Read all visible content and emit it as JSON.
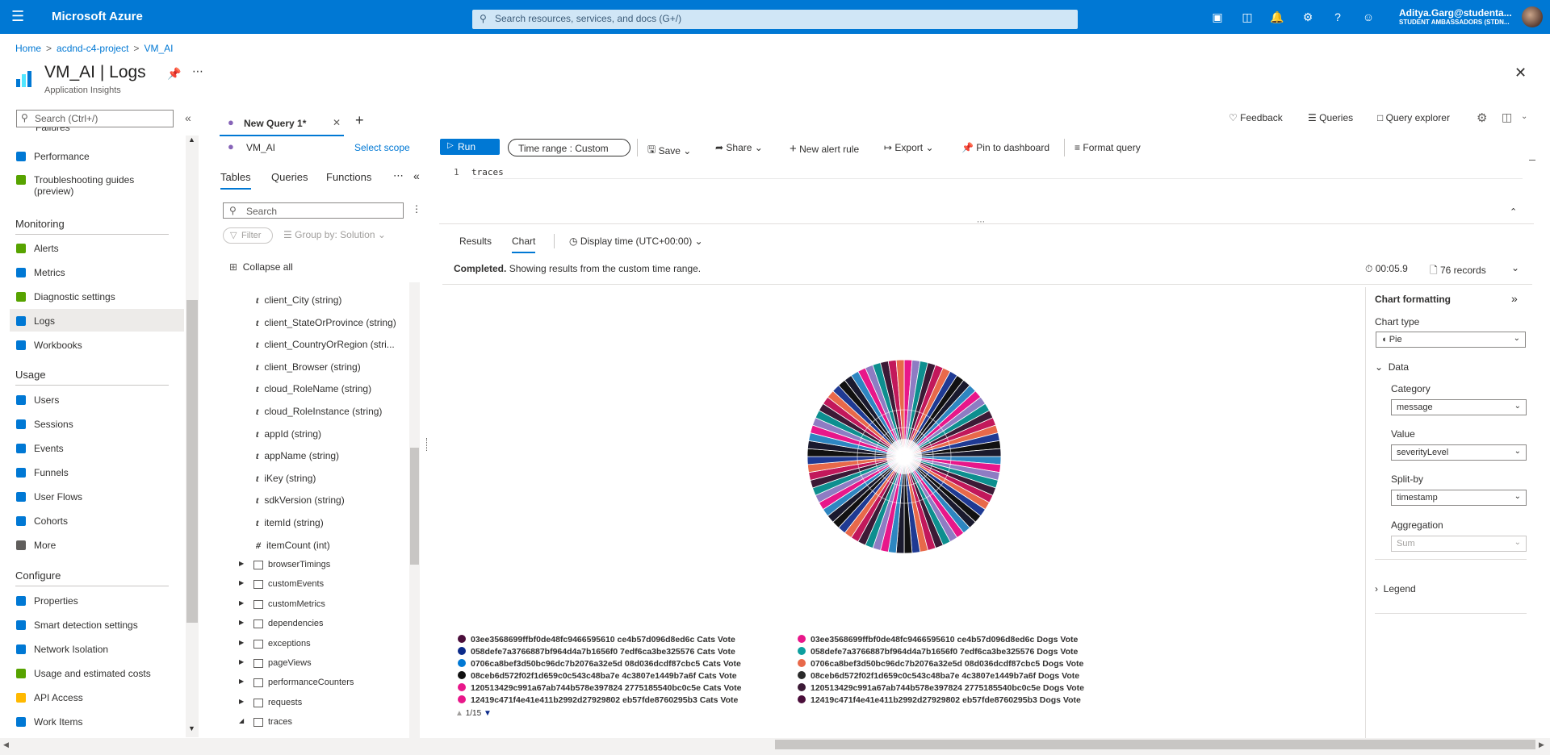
{
  "topbar": {
    "brand": "Microsoft Azure",
    "search_placeholder": "Search resources, services, and docs (G+/)",
    "user_name": "Aditya.Garg@studenta...",
    "user_org": "STUDENT AMBASSADORS (STDN..."
  },
  "breadcrumb": [
    "Home",
    "acdnd-c4-project",
    "VM_AI"
  ],
  "page": {
    "title": "VM_AI | Logs",
    "subtitle": "Application Insights"
  },
  "leftnav": {
    "search_placeholder": "Search (Ctrl+/)",
    "partial_item": "Failures",
    "items_top": [
      {
        "label": "Performance",
        "color": "#0078d4"
      },
      {
        "label": "Troubleshooting guides",
        "label2": "(preview)",
        "color": "#57a300"
      }
    ],
    "monitoring": {
      "title": "Monitoring",
      "items": [
        {
          "label": "Alerts",
          "color": "#57a300"
        },
        {
          "label": "Metrics",
          "color": "#0078d4"
        },
        {
          "label": "Diagnostic settings",
          "color": "#57a300"
        },
        {
          "label": "Logs",
          "color": "#0078d4"
        },
        {
          "label": "Workbooks",
          "color": "#0078d4"
        }
      ]
    },
    "usage": {
      "title": "Usage",
      "items": [
        {
          "label": "Users",
          "color": "#0078d4"
        },
        {
          "label": "Sessions",
          "color": "#0078d4"
        },
        {
          "label": "Events",
          "color": "#0078d4"
        },
        {
          "label": "Funnels",
          "color": "#0078d4"
        },
        {
          "label": "User Flows",
          "color": "#0078d4"
        },
        {
          "label": "Cohorts",
          "color": "#0078d4"
        },
        {
          "label": "More",
          "color": "#605e5c"
        }
      ]
    },
    "configure": {
      "title": "Configure",
      "items": [
        {
          "label": "Properties",
          "color": "#0078d4"
        },
        {
          "label": "Smart detection settings",
          "color": "#0078d4"
        },
        {
          "label": "Network Isolation",
          "color": "#0078d4"
        },
        {
          "label": "Usage and estimated costs",
          "color": "#57a300"
        },
        {
          "label": "API Access",
          "color": "#ffb900"
        },
        {
          "label": "Work Items",
          "color": "#0078d4"
        }
      ]
    }
  },
  "query_tab": {
    "label": "New Query 1*",
    "add": "+"
  },
  "scope": {
    "name": "VM_AI",
    "select_scope": "Select scope"
  },
  "toolbar": {
    "run": "Run",
    "time_range_label": "Time range :",
    "time_range_value": "Custom",
    "save": "Save",
    "share": "Share",
    "new_alert": "New alert rule",
    "export": "Export",
    "pin": "Pin to dashboard",
    "format": "Format query"
  },
  "right_toolbar": {
    "feedback": "Feedback",
    "queries": "Queries",
    "query_explorer": "Query explorer"
  },
  "schema": {
    "tabs": [
      "Tables",
      "Queries",
      "Functions"
    ],
    "search_placeholder": "Search",
    "filter": "Filter",
    "group_by": "Group by: Solution",
    "collapse_all": "Collapse all",
    "fields": [
      {
        "t": "t",
        "name": "client_City (string)"
      },
      {
        "t": "t",
        "name": "client_StateOrProvince (string)"
      },
      {
        "t": "t",
        "name": "client_CountryOrRegion (stri..."
      },
      {
        "t": "t",
        "name": "client_Browser (string)"
      },
      {
        "t": "t",
        "name": "cloud_RoleName (string)"
      },
      {
        "t": "t",
        "name": "cloud_RoleInstance (string)"
      },
      {
        "t": "t",
        "name": "appId (string)"
      },
      {
        "t": "t",
        "name": "appName (string)"
      },
      {
        "t": "t",
        "name": "iKey (string)"
      },
      {
        "t": "t",
        "name": "sdkVersion (string)"
      },
      {
        "t": "t",
        "name": "itemId (string)"
      },
      {
        "t": "#",
        "name": "itemCount (int)"
      }
    ],
    "tables": [
      "browserTimings",
      "customEvents",
      "customMetrics",
      "dependencies",
      "exceptions",
      "pageViews",
      "performanceCounters",
      "requests",
      "traces"
    ]
  },
  "editor": {
    "line": "1",
    "code": "traces"
  },
  "results": {
    "tabs": [
      "Results",
      "Chart"
    ],
    "display_time": "Display time (UTC+00:00)",
    "status_bold": "Completed.",
    "status_text": "Showing results from the custom time range.",
    "duration": "00:05.9",
    "records": "76 records"
  },
  "chart_formatting": {
    "title": "Chart formatting",
    "chart_type_label": "Chart type",
    "chart_type": "Pie",
    "data_label": "Data",
    "category_label": "Category",
    "category": "message",
    "value_label": "Value",
    "value": "severityLevel",
    "splitby_label": "Split-by",
    "splitby": "timestamp",
    "aggregation_label": "Aggregation",
    "aggregation": "Sum",
    "legend_label": "Legend"
  },
  "chart_data": {
    "type": "pie",
    "slice_count": 76,
    "palette": [
      "#e8178a",
      "#3c1a36",
      "#1f3a93",
      "#2e86c1",
      "#0d8f8f",
      "#e8694a",
      "#1a1a2e",
      "#8e7cc3",
      "#c2185b",
      "#111111"
    ],
    "legend_left": [
      {
        "label": "03ee3568699ffbf0de48fc9466595610 ce4b57d096d8ed6c Cats Vote",
        "color": "#4a0e3a"
      },
      {
        "label": "058defe7a3766887bf964d4a7b1656f0 7edf6ca3be325576 Cats Vote",
        "color": "#0b2a8a"
      },
      {
        "label": "0706ca8bef3d50bc96dc7b2076a32e5d 08d036dcdf87cbc5 Cats Vote",
        "color": "#0078d4"
      },
      {
        "label": "08ceb6d572f02f1d659c0c543c48ba7e 4c3807e1449b7a6f Cats Vote",
        "color": "#111111"
      },
      {
        "label": "120513429c991a67ab744b578e397824 2775185540bc0c5e Cats Vote",
        "color": "#e8178a"
      },
      {
        "label": "12419c471f4e41e411b2992d27929802 eb57fde8760295b3 Cats Vote",
        "color": "#e8178a"
      }
    ],
    "legend_right": [
      {
        "label": "03ee3568699ffbf0de48fc9466595610 ce4b57d096d8ed6c Dogs Vote",
        "color": "#e8178a"
      },
      {
        "label": "058defe7a3766887bf964d4a7b1656f0 7edf6ca3be325576 Dogs Vote",
        "color": "#0d9f9f"
      },
      {
        "label": "0706ca8bef3d50bc96dc7b2076a32e5d 08d036dcdf87cbc5 Dogs Vote",
        "color": "#e8694a"
      },
      {
        "label": "08ceb6d572f02f1d659c0c543c48ba7e 4c3807e1449b7a6f Dogs Vote",
        "color": "#2a2a2a"
      },
      {
        "label": "120513429c991a67ab744b578e397824 2775185540bc0c5e Dogs Vote",
        "color": "#3c1a36"
      },
      {
        "label": "12419c471f4e41e411b2992d27929802 eb57fde8760295b3 Dogs Vote",
        "color": "#4a0e3a"
      }
    ],
    "pager": "1/15"
  }
}
